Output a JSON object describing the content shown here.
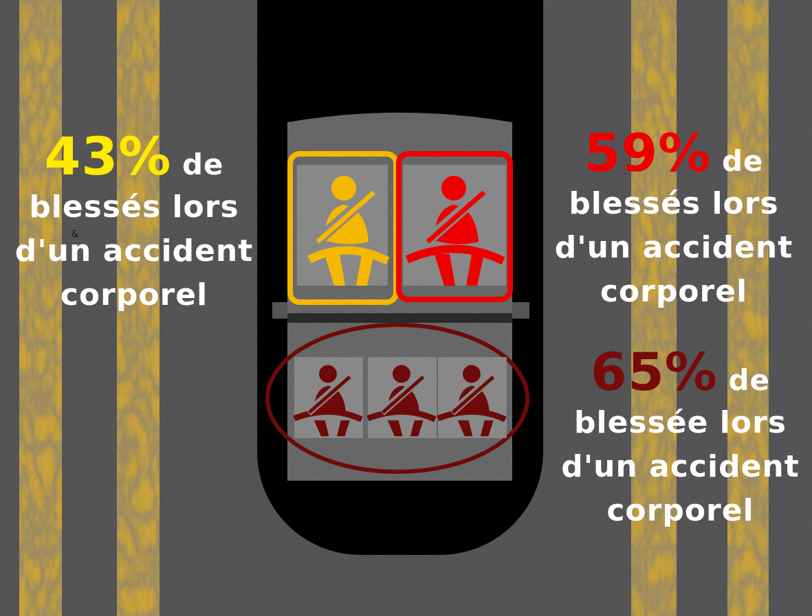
{
  "stats": {
    "left": {
      "percent": "43%",
      "suffix": " de",
      "lines": [
        "blessés lors",
        "d'un accident",
        "corporel"
      ],
      "color": "#ffea00"
    },
    "right_top": {
      "percent": "59%",
      "suffix": " de",
      "lines": [
        "blessés lors",
        "d'un accident",
        "corporel"
      ],
      "color": "#ee0000"
    },
    "right_bottom": {
      "percent": "65%",
      "suffix": " de",
      "lines": [
        "blessée lors",
        "d'un accident",
        "corporel"
      ],
      "color": "#7a0a0a"
    }
  },
  "stray_mark": "&",
  "seats": {
    "driver": {
      "icon": "seatbelt-person-icon",
      "color": "#f5b800"
    },
    "passenger": {
      "icon": "seatbelt-person-icon",
      "color": "#ee0000"
    },
    "rear": {
      "icon": "seatbelt-person-icon",
      "color": "#6e0a0a",
      "count": 3
    }
  },
  "colors": {
    "asphalt": "#3b3b3d",
    "road_line": "#c8a13a",
    "car_body": "#000000",
    "tile": "#888888"
  }
}
